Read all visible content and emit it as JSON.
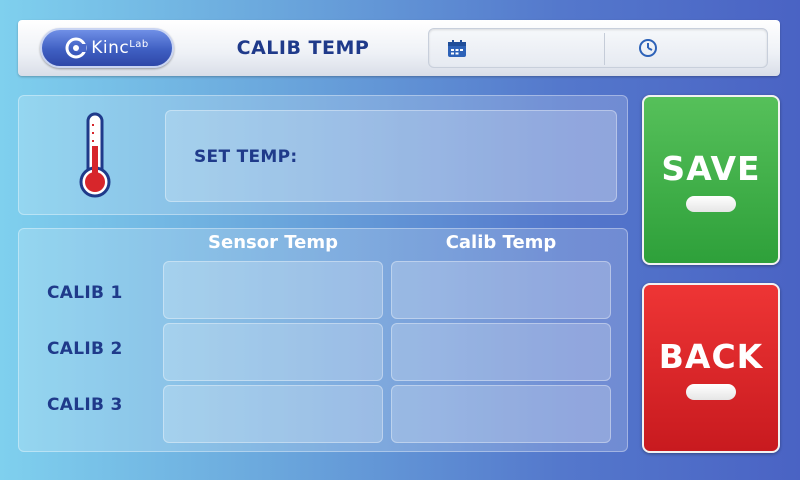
{
  "header": {
    "logo_text": "Kinc",
    "logo_sub": "Lab",
    "title": "CALIB TEMP",
    "date_value": "",
    "time_value": ""
  },
  "set_temp": {
    "label": "SET TEMP:",
    "value": ""
  },
  "calib_table": {
    "columns": [
      "Sensor Temp",
      "Calib Temp"
    ],
    "rows": [
      {
        "label": "CALIB 1",
        "sensor": "",
        "calib": ""
      },
      {
        "label": "CALIB 2",
        "sensor": "",
        "calib": ""
      },
      {
        "label": "CALIB 3",
        "sensor": "",
        "calib": ""
      }
    ]
  },
  "buttons": {
    "save": "SAVE",
    "back": "BACK"
  },
  "colors": {
    "accent_text": "#1f3a8a",
    "save_green": "#2ea03a",
    "back_red": "#c81a1f"
  },
  "icons": {
    "logo": "kinclab-logo-icon",
    "date": "calendar-icon",
    "time": "clock-icon",
    "thermometer": "thermometer-icon"
  }
}
